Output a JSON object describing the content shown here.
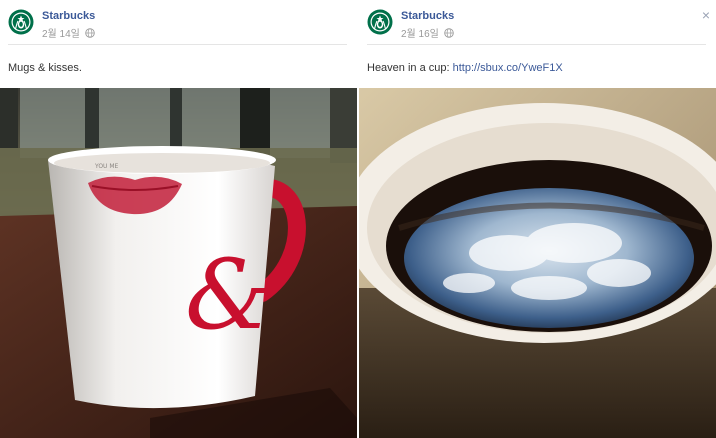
{
  "posts": [
    {
      "page_name": "Starbucks",
      "date": "2월 14일",
      "caption": "Mugs & kisses.",
      "link": "",
      "photo": {
        "mug_text": "YOU  ME",
        "ampersand": "&",
        "subject": "white mug with red lipstick kiss and red ampersand"
      }
    },
    {
      "page_name": "Starbucks",
      "date": "2월 16일",
      "caption": "Heaven in a cup: ",
      "link": "http://sbux.co/YweF1X",
      "photo": {
        "subject": "cup of black coffee reflecting blue sky and clouds"
      }
    }
  ],
  "close_glyph": "×",
  "icons": [
    "starbucks-logo",
    "globe-icon",
    "close-icon"
  ],
  "colors": {
    "link": "#3b5998",
    "meta": "#999999",
    "brand_green": "#00704a",
    "mug_red": "#c8102e"
  }
}
